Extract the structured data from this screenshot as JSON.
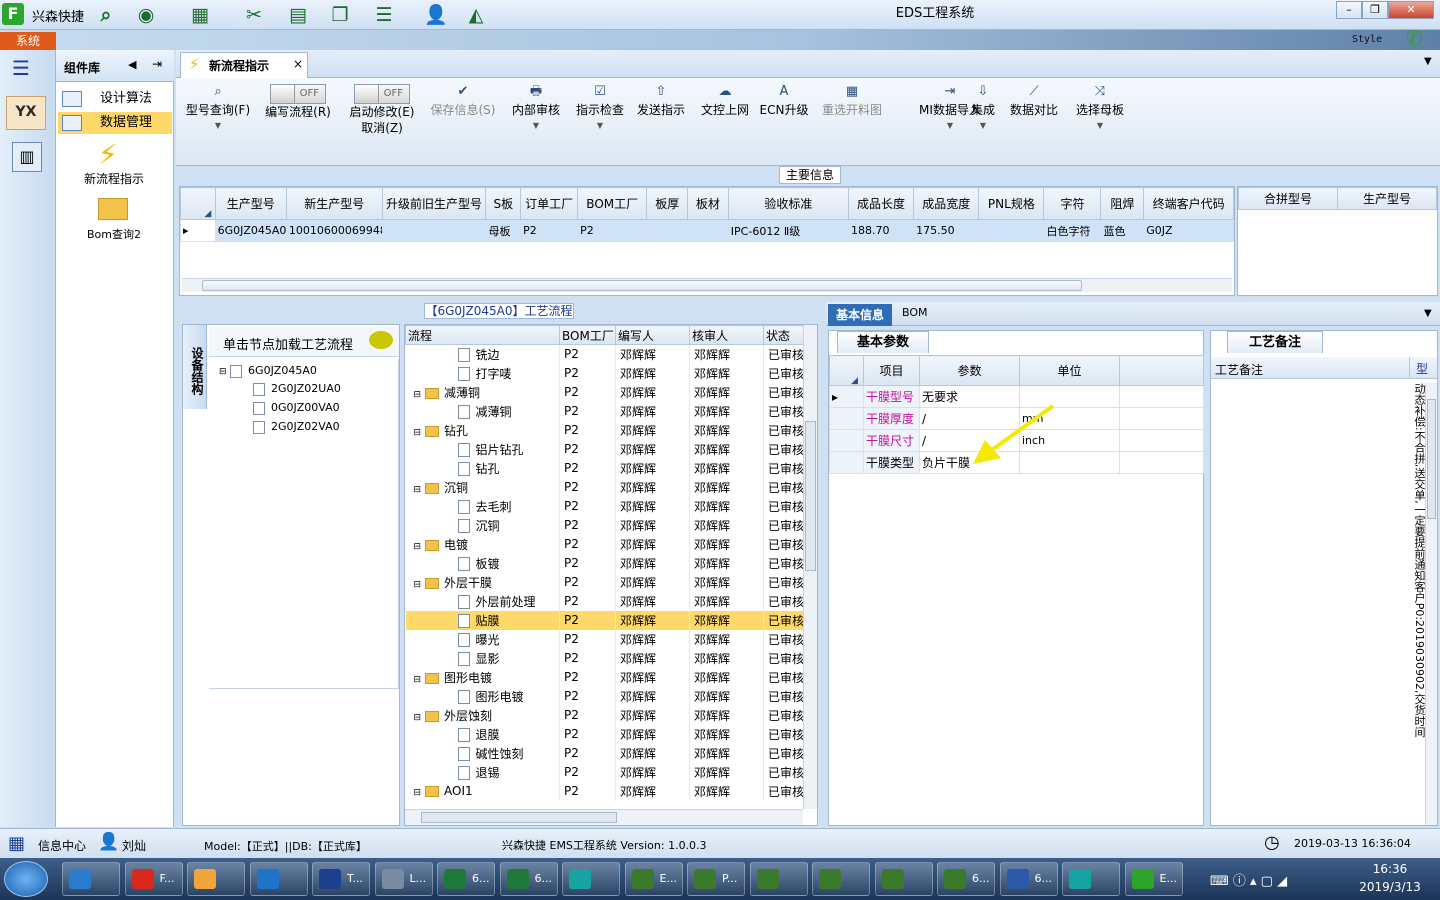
{
  "app": {
    "name": "兴森快捷",
    "window_title": "EDS工程系统",
    "style_label": "Style"
  },
  "sysbar": {
    "tab": "系统"
  },
  "quick_toolbar": [
    "search-icon",
    "globe-icon",
    "grid-icon",
    "scissors-icon",
    "film-icon",
    "copy-icon",
    "list-icon",
    "user-icon",
    "chart-icon"
  ],
  "window_controls": [
    "minimize",
    "restore",
    "close"
  ],
  "component_library": {
    "title": "组件库",
    "items": [
      {
        "label": "设计算法",
        "selected": false
      },
      {
        "label": "数据管理",
        "selected": true
      }
    ],
    "tiles": [
      {
        "label": "新流程指示",
        "icon": "lightning-icon"
      },
      {
        "label": "Bom查询2",
        "icon": "folder-icon"
      }
    ]
  },
  "left_strip": {
    "logo": "YX"
  },
  "tab": {
    "label": "新流程指示",
    "close": "×"
  },
  "ribbon": {
    "model_query": "型号查询(F)",
    "edit_flow": {
      "toggle": "OFF",
      "label": "编写流程(R)"
    },
    "start_modify": {
      "toggle": "OFF",
      "label": "启动修改(E)",
      "cancel": "取消(Z)"
    },
    "buttons": [
      {
        "label": "保存信息(S)",
        "disabled": true,
        "icon": "✔"
      },
      {
        "label": "内部审核",
        "disabled": false,
        "icon": "🖶"
      },
      {
        "label": "指示检查",
        "disabled": false,
        "icon": "☑"
      },
      {
        "label": "发送指示",
        "disabled": false,
        "icon": "⇧"
      },
      {
        "label": "文控上网",
        "disabled": false,
        "icon": "☁"
      },
      {
        "label": "ECN升级",
        "disabled": false,
        "icon": "A"
      },
      {
        "label": "重选开料图",
        "disabled": true,
        "icon": "▦"
      },
      {
        "label": "MI数据导入",
        "disabled": false,
        "icon": "⇥"
      },
      {
        "label": "集成",
        "disabled": false,
        "icon": "⇩"
      },
      {
        "label": "数据对比",
        "disabled": false,
        "icon": "⟋"
      },
      {
        "label": "选择母板",
        "disabled": false,
        "icon": "⤨"
      }
    ]
  },
  "main_info": {
    "title": "主要信息",
    "columns": [
      "生产型号",
      "新生产型号",
      "升级前旧生产型号",
      "S板",
      "订单工厂",
      "BOM工厂",
      "板厚",
      "板材",
      "验收标准",
      "成品长度",
      "成品宽度",
      "PNL规格",
      "字符",
      "阻焊",
      "终端客户代码"
    ],
    "row": [
      "6G0JZ045A0",
      "10010600069948",
      "",
      "母板",
      "P2",
      "P2",
      "",
      "",
      "IPC-6012 Ⅱ级",
      "188.70",
      "175.50",
      "",
      "白色字符",
      "蓝色",
      "G0JZ"
    ],
    "side_columns": [
      "合拼型号",
      "生产型号"
    ]
  },
  "flow_title": "【6G0JZ045A0】工艺流程",
  "device_panel": {
    "vtab": "设备结构",
    "hint": "单击节点加载工艺流程",
    "tree": [
      "6G0JZ045A0",
      "2G0JZ02UA0",
      "0G0JZ00VA0",
      "2G0JZ02VA0"
    ]
  },
  "flow_grid": {
    "columns": [
      "流程",
      "BOM工厂",
      "编写人",
      "核审人",
      "状态"
    ],
    "rows": [
      {
        "name": "铣边",
        "level": 2,
        "factory": "P2",
        "writer": "邓辉辉",
        "reviewer": "邓辉辉",
        "status": "已审核"
      },
      {
        "name": "打字唛",
        "level": 2,
        "factory": "P2",
        "writer": "邓辉辉",
        "reviewer": "邓辉辉",
        "status": "已审核"
      },
      {
        "name": "减薄铜",
        "level": 1,
        "factory": "P2",
        "writer": "邓辉辉",
        "reviewer": "邓辉辉",
        "status": "已审核"
      },
      {
        "name": "减薄铜",
        "level": 2,
        "factory": "P2",
        "writer": "邓辉辉",
        "reviewer": "邓辉辉",
        "status": "已审核"
      },
      {
        "name": "钻孔",
        "level": 1,
        "factory": "P2",
        "writer": "邓辉辉",
        "reviewer": "邓辉辉",
        "status": "已审核"
      },
      {
        "name": "铝片钻孔",
        "level": 2,
        "factory": "P2",
        "writer": "邓辉辉",
        "reviewer": "邓辉辉",
        "status": "已审核"
      },
      {
        "name": "钻孔",
        "level": 2,
        "factory": "P2",
        "writer": "邓辉辉",
        "reviewer": "邓辉辉",
        "status": "已审核"
      },
      {
        "name": "沉铜",
        "level": 1,
        "factory": "P2",
        "writer": "邓辉辉",
        "reviewer": "邓辉辉",
        "status": "已审核"
      },
      {
        "name": "去毛刺",
        "level": 2,
        "factory": "P2",
        "writer": "邓辉辉",
        "reviewer": "邓辉辉",
        "status": "已审核"
      },
      {
        "name": "沉铜",
        "level": 2,
        "factory": "P2",
        "writer": "邓辉辉",
        "reviewer": "邓辉辉",
        "status": "已审核"
      },
      {
        "name": "电镀",
        "level": 1,
        "factory": "P2",
        "writer": "邓辉辉",
        "reviewer": "邓辉辉",
        "status": "已审核"
      },
      {
        "name": "板镀",
        "level": 2,
        "factory": "P2",
        "writer": "邓辉辉",
        "reviewer": "邓辉辉",
        "status": "已审核"
      },
      {
        "name": "外层干膜",
        "level": 1,
        "factory": "P2",
        "writer": "邓辉辉",
        "reviewer": "邓辉辉",
        "status": "已审核"
      },
      {
        "name": "外层前处理",
        "level": 2,
        "factory": "P2",
        "writer": "邓辉辉",
        "reviewer": "邓辉辉",
        "status": "已审核"
      },
      {
        "name": "贴膜",
        "level": 2,
        "factory": "P2",
        "writer": "邓辉辉",
        "reviewer": "邓辉辉",
        "status": "已审核",
        "selected": true
      },
      {
        "name": "曝光",
        "level": 2,
        "factory": "P2",
        "writer": "邓辉辉",
        "reviewer": "邓辉辉",
        "status": "已审核"
      },
      {
        "name": "显影",
        "level": 2,
        "factory": "P2",
        "writer": "邓辉辉",
        "reviewer": "邓辉辉",
        "status": "已审核"
      },
      {
        "name": "图形电镀",
        "level": 1,
        "factory": "P2",
        "writer": "邓辉辉",
        "reviewer": "邓辉辉",
        "status": "已审核"
      },
      {
        "name": "图形电镀",
        "level": 2,
        "factory": "P2",
        "writer": "邓辉辉",
        "reviewer": "邓辉辉",
        "status": "已审核"
      },
      {
        "name": "外层蚀刻",
        "level": 1,
        "factory": "P2",
        "writer": "邓辉辉",
        "reviewer": "邓辉辉",
        "status": "已审核"
      },
      {
        "name": "退膜",
        "level": 2,
        "factory": "P2",
        "writer": "邓辉辉",
        "reviewer": "邓辉辉",
        "status": "已审核"
      },
      {
        "name": "碱性蚀刻",
        "level": 2,
        "factory": "P2",
        "writer": "邓辉辉",
        "reviewer": "邓辉辉",
        "status": "已审核"
      },
      {
        "name": "退锡",
        "level": 2,
        "factory": "P2",
        "writer": "邓辉辉",
        "reviewer": "邓辉辉",
        "status": "已审核"
      },
      {
        "name": "AOI1",
        "level": 1,
        "factory": "P2",
        "writer": "邓辉辉",
        "reviewer": "邓辉辉",
        "status": "已审核"
      }
    ]
  },
  "detail": {
    "tabs": [
      "基本信息",
      "BOM"
    ],
    "basic_params": {
      "tab": "基本参数",
      "columns": [
        "项目",
        "参数",
        "单位"
      ],
      "rows": [
        {
          "item": "干膜型号",
          "param": "无要求",
          "unit": "",
          "highlight": true
        },
        {
          "item": "干膜厚度",
          "param": "/",
          "unit": "mm",
          "highlight": true
        },
        {
          "item": "干膜尺寸",
          "param": "/",
          "unit": "inch",
          "highlight": true
        },
        {
          "item": "干膜类型",
          "param": "负片干膜",
          "unit": "",
          "highlight": false
        }
      ]
    },
    "notes": {
      "tab": "工艺备注",
      "column": "工艺备注",
      "type_col": "型",
      "vertical_text": "动态补偿:不合拼,送交单,一定要提前通知客户P0:2019030902,交货时间"
    }
  },
  "status": {
    "help": "信息中心",
    "user": "刘灿",
    "model": "Model:【正式】||DB:【正式库】",
    "version": "兴森快捷 EMS工程系统 Version: 1.0.0.3",
    "datetime": "2019-03-13 16:36:04"
  },
  "taskbar": {
    "time": "16:36",
    "date": "2019/3/13",
    "items": [
      {
        "label": "",
        "color": "#2b7bd1"
      },
      {
        "label": "F...",
        "color": "#d9291c"
      },
      {
        "label": "",
        "color": "#f2a33a"
      },
      {
        "label": "",
        "color": "#1f73c9"
      },
      {
        "label": "T...",
        "color": "#1d3f8f"
      },
      {
        "label": "L...",
        "color": "#7a8aa0"
      },
      {
        "label": "6...",
        "color": "#1f7a3a"
      },
      {
        "label": "6...",
        "color": "#1f7a3a"
      },
      {
        "label": "",
        "color": "#18a3a3"
      },
      {
        "label": "E...",
        "color": "#3a7a2a"
      },
      {
        "label": "P...",
        "color": "#3a7a2a"
      },
      {
        "label": "",
        "color": "#3a7a2a"
      },
      {
        "label": "",
        "color": "#3a7a2a"
      },
      {
        "label": "",
        "color": "#3a7a2a"
      },
      {
        "label": "6...",
        "color": "#3a7a2a"
      },
      {
        "label": "6...",
        "color": "#2b5aa8"
      },
      {
        "label": "",
        "color": "#18a3a3"
      },
      {
        "label": "E...",
        "color": "#2da52d"
      }
    ]
  }
}
